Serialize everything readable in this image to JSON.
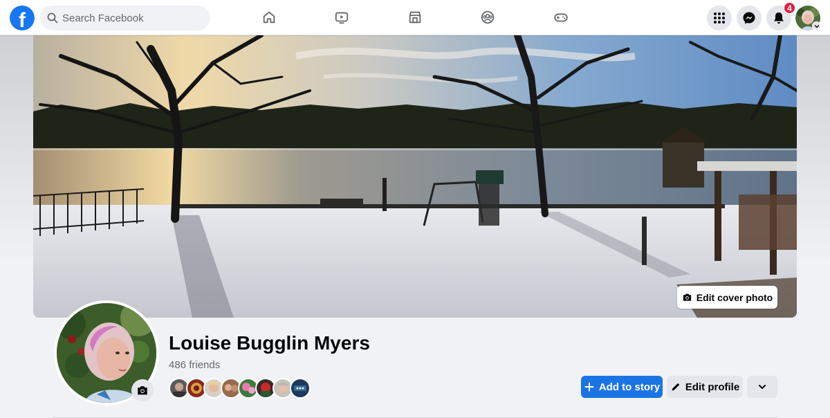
{
  "topbar": {
    "logo_letter": "f",
    "search": {
      "placeholder": "Search Facebook",
      "value": ""
    },
    "nav_tabs": [
      {
        "icon": "home-icon"
      },
      {
        "icon": "watch-icon"
      },
      {
        "icon": "marketplace-icon"
      },
      {
        "icon": "groups-icon"
      },
      {
        "icon": "gaming-icon"
      }
    ],
    "right_buttons": [
      {
        "icon": "menu-grid-icon"
      },
      {
        "icon": "messenger-icon"
      },
      {
        "icon": "notifications-icon",
        "badge": "4"
      }
    ]
  },
  "cover": {
    "edit_cover_label": "Edit cover photo"
  },
  "profile": {
    "name": "Louise Bugglin Myers",
    "friends_count": "486 friends",
    "friend_faces_count": 8
  },
  "actions": {
    "add_to_story": "Add to story",
    "edit_profile": "Edit profile"
  },
  "colors": {
    "brand_blue": "#1877f2",
    "primary_button": "#1b74e4",
    "badge_red": "#e41e3f",
    "secondary_button": "#e4e6eb",
    "page_bg": "#f0f2f5"
  }
}
